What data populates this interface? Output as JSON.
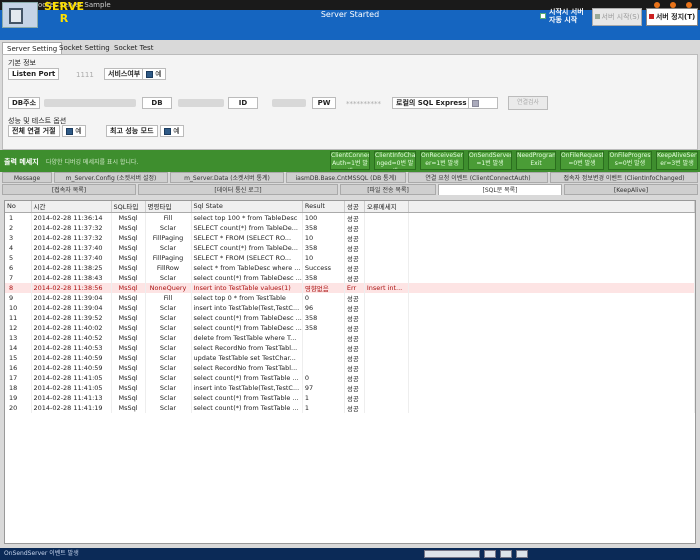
{
  "window": {
    "title": "IASM Socket Server Sample"
  },
  "header": {
    "brand": "SERVE R",
    "status": "Server Started",
    "autostart": "시작시 서버 자동 시작",
    "start_label": "서버 시작(S)",
    "stop_label": "서버 정지(T)"
  },
  "tabs": [
    "Server Setting",
    "Socket Setting",
    "Socket Test"
  ],
  "settings": {
    "basic_title": "기본 정보",
    "listen_port_label": "Listen Port",
    "listen_port_value": "1111",
    "service_label": "서비스여부",
    "service_value": "예",
    "db_addr_label": "DB주소",
    "db_label": "DB",
    "id_label": "ID",
    "pw_label": "PW",
    "pw_value": "**********",
    "sql_express_label": "로컬의 SQL Express",
    "connect_button": "연결검사",
    "perf_title": "성능 및 테스트 옵션",
    "full_log_label": "전체 연결 거절",
    "full_log_value": "예",
    "max_perf_label": "최고 성능 모드",
    "max_perf_value": "예"
  },
  "output": {
    "title": "출력 메세지",
    "hint": "다양한 디버깅 메세지를 표시 합니다.",
    "events": [
      "ClientConnect Auth=1번 발생",
      "ClientInfoCha nged=0번 발생",
      "OnReceiveServ er=1번 발생",
      "OnSendServer =1번 발생",
      "NeedProgram Exit",
      "OnFileRequest =0번 발생",
      "OnFileProgres s=0번 발생",
      "KeepAliveServ er=3번 발생"
    ]
  },
  "tabs_row1": [
    "Message",
    "m_Server.Config (소켓서버 설정)",
    "m_Server.Data (소켓서버 통계)",
    "iasmDB.Base.CntMSSQL (DB 통계)",
    "연결 요청 이벤트 (ClientConnectAuth)",
    "접속자 정보변경 이벤트 (ClientInfoChanged)"
  ],
  "tabs_row2": [
    "[접속자 목록]",
    "[데이터 통신 로그]",
    "[파일 전송 목록]",
    "[SQL문 목록]",
    "[KeepAlive]"
  ],
  "grid": {
    "columns": [
      "No",
      "시간",
      "SQL타입",
      "명령타입",
      "Sql State",
      "Result",
      "성공",
      "오류메세지"
    ],
    "rows": [
      [
        "1",
        "2014-02-28 11:36:14",
        "MsSql",
        "Fill",
        "select top 100 * from TableDesc",
        "100",
        "성공",
        ""
      ],
      [
        "2",
        "2014-02-28 11:37:32",
        "MsSql",
        "Sclar",
        "SELECT count(*) from  TableDe...",
        "358",
        "성공",
        ""
      ],
      [
        "3",
        "2014-02-28 11:37:32",
        "MsSql",
        "FillPaging",
        "SELECT  *   FROM  (SELECT RO...",
        "10",
        "성공",
        ""
      ],
      [
        "4",
        "2014-02-28 11:37:40",
        "MsSql",
        "Sclar",
        "SELECT count(*) from  TableDe...",
        "358",
        "성공",
        ""
      ],
      [
        "5",
        "2014-02-28 11:37:40",
        "MsSql",
        "FillPaging",
        "SELECT  *   FROM  (SELECT RO...",
        "10",
        "성공",
        ""
      ],
      [
        "6",
        "2014-02-28 11:38:25",
        "MsSql",
        "FillRow",
        "select * from TableDesc where ...",
        "Success",
        "성공",
        ""
      ],
      [
        "7",
        "2014-02-28 11:38:43",
        "MsSql",
        "Sclar",
        "select count(*) from TableDesc ...",
        "358",
        "성공",
        ""
      ],
      [
        "8",
        "2014-02-28 11:38:56",
        "MsSql",
        "NoneQuery",
        "Insert into TestTable values(1)",
        "영향없음",
        "Err",
        "Insert int..."
      ],
      [
        "9",
        "2014-02-28 11:39:04",
        "MsSql",
        "Fill",
        "select top 0 * from TestTable",
        "0",
        "성공",
        ""
      ],
      [
        "10",
        "2014-02-28 11:39:04",
        "MsSql",
        "Sclar",
        "insert into TestTable(Test,TestC...",
        "96",
        "성공",
        ""
      ],
      [
        "11",
        "2014-02-28 11:39:52",
        "MsSql",
        "Sclar",
        "select count(*) from TableDesc ...",
        "358",
        "성공",
        ""
      ],
      [
        "12",
        "2014-02-28 11:40:02",
        "MsSql",
        "Sclar",
        "select count(*) from TableDesc ...",
        "358",
        "성공",
        ""
      ],
      [
        "13",
        "2014-02-28 11:40:52",
        "MsSql",
        "Sclar",
        "delete from TestTable where T...",
        "",
        "성공",
        ""
      ],
      [
        "14",
        "2014-02-28 11:40:53",
        "MsSql",
        "Sclar",
        "select RecordNo from TestTabl...",
        "",
        "성공",
        ""
      ],
      [
        "15",
        "2014-02-28 11:40:59",
        "MsSql",
        "Sclar",
        "update TestTable set TestChar...",
        "",
        "성공",
        ""
      ],
      [
        "16",
        "2014-02-28 11:40:59",
        "MsSql",
        "Sclar",
        "select RecordNo from TestTabl...",
        "",
        "성공",
        ""
      ],
      [
        "17",
        "2014-02-28 11:41:05",
        "MsSql",
        "Sclar",
        "select count(*) from TestTable ...",
        "0",
        "성공",
        ""
      ],
      [
        "18",
        "2014-02-28 11:41:05",
        "MsSql",
        "Sclar",
        "insert into TestTable(Test,TestC...",
        "97",
        "성공",
        ""
      ],
      [
        "19",
        "2014-02-28 11:41:13",
        "MsSql",
        "Sclar",
        "select count(*) from TestTable ...",
        "1",
        "성공",
        ""
      ],
      [
        "20",
        "2014-02-28 11:41:19",
        "MsSql",
        "Sclar",
        "select count(*) from TestTable ...",
        "1",
        "성공",
        ""
      ]
    ]
  },
  "statusbar": {
    "text": "OnSendServer 이벤트 발생"
  }
}
